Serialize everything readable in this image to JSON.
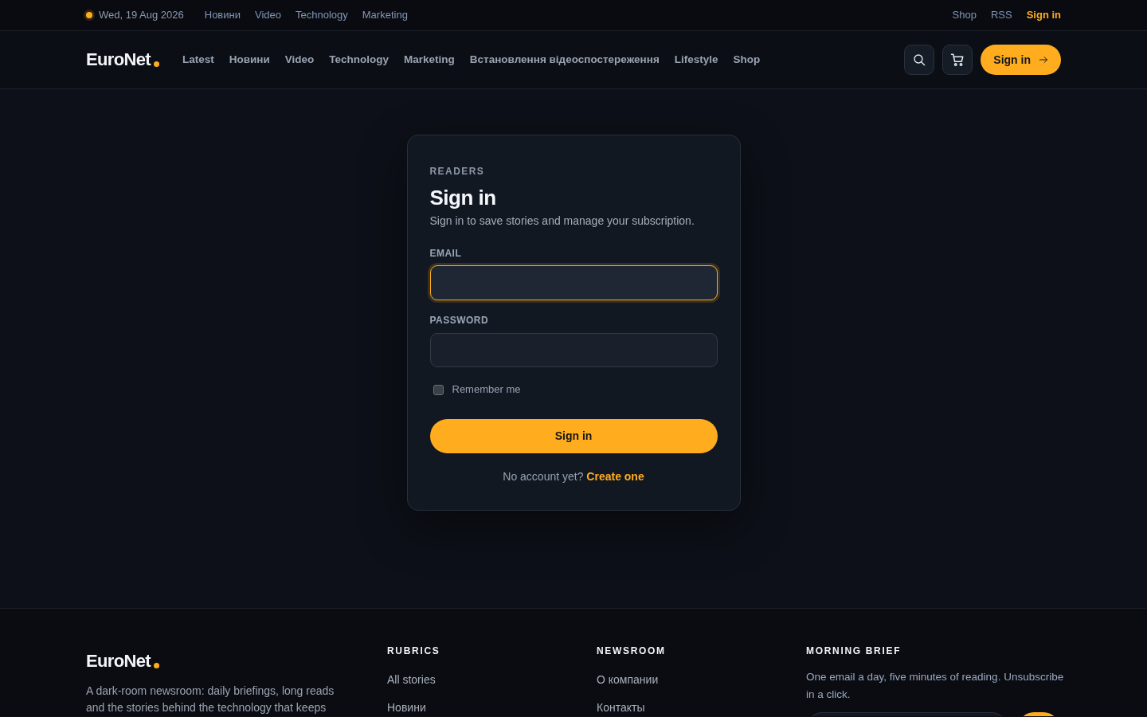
{
  "topbar": {
    "date": "Wed, 19 Aug 2026",
    "links": [
      "Новини",
      "Video",
      "Technology",
      "Marketing"
    ],
    "right_links": [
      {
        "label": "Shop",
        "kind": "plain"
      },
      {
        "label": "RSS",
        "kind": "plain"
      },
      {
        "label": "Sign in",
        "kind": "accent"
      }
    ]
  },
  "navbar": {
    "logo": "EuroNet",
    "links": [
      "Latest",
      "Новини",
      "Video",
      "Technology",
      "Marketing",
      "Встановлення відеоспостереження",
      "Lifestyle",
      "Shop"
    ],
    "sign_in_button": "Sign in"
  },
  "login_card": {
    "eyebrow": "READERS",
    "title": "Sign in",
    "subtitle": "Sign in to save stories and manage your subscription.",
    "fields": [
      {
        "label": "EMAIL",
        "focused": true
      },
      {
        "label": "PASSWORD",
        "focused": false
      }
    ],
    "remember": {
      "label": "Remember me",
      "checked": false
    },
    "submit": "Sign in",
    "prompt": "No account yet?",
    "prompt_link": "Create one"
  },
  "footer": {
    "logo": "EuroNet",
    "about": "A dark-room newsroom: daily briefings, long reads and the stories behind the technology that keeps",
    "columns": [
      {
        "title": "RUBRICS",
        "links": [
          "All stories",
          "Новини"
        ]
      },
      {
        "title": "NEWSROOM",
        "links": [
          "О компании",
          "Контакты"
        ]
      }
    ],
    "newsletter": {
      "title": "MORNING BRIEF",
      "text": "One email a day, five minutes of reading. Unsubscribe in a click."
    }
  }
}
